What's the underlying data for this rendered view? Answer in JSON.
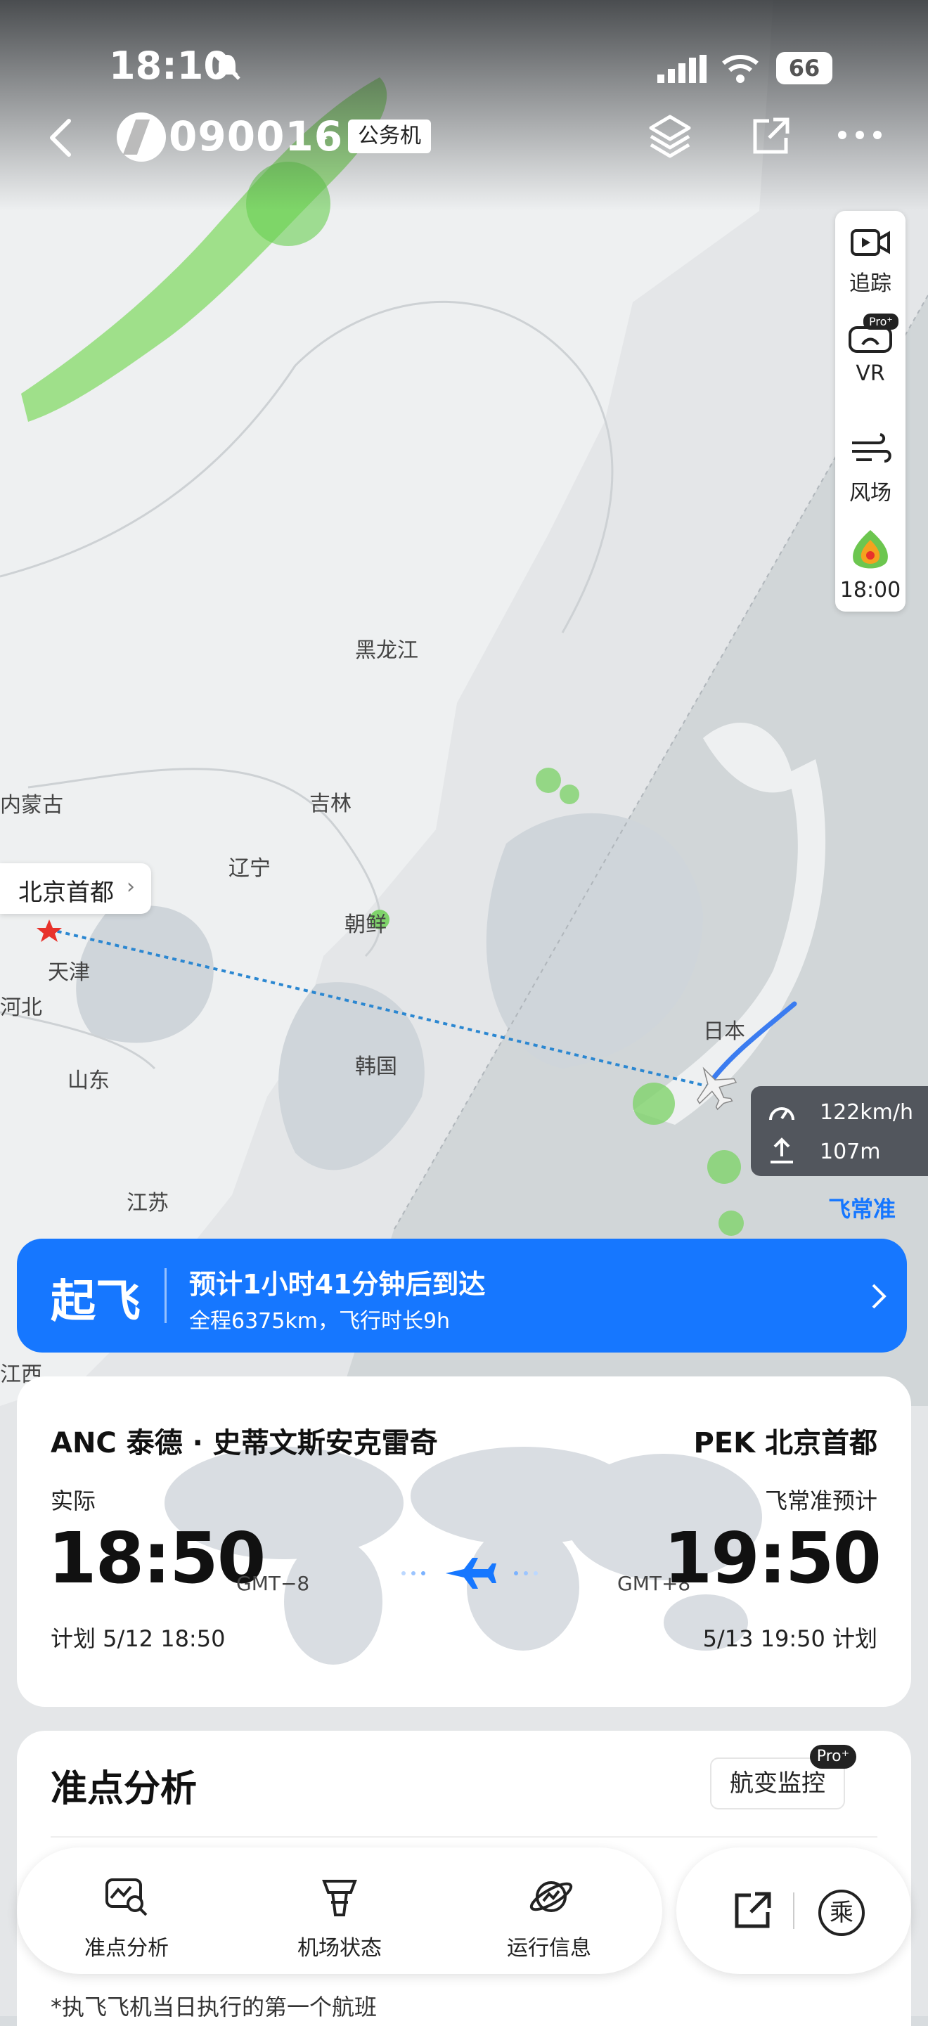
{
  "status": {
    "time": "18:10",
    "battery": "66"
  },
  "header": {
    "flight_no": "090016",
    "tag": "公务机"
  },
  "right_panel": {
    "track": "追踪",
    "vr": "VR",
    "vr_badge": "Pro⁺",
    "wind": "风场",
    "weather_time": "18:00"
  },
  "map": {
    "origin_label": "北京首都",
    "regions": [
      "黑龙江",
      "吉林",
      "辽宁",
      "内蒙古",
      "朝鲜",
      "天津",
      "河北",
      "山东",
      "韩国",
      "日本",
      "江苏",
      "江西"
    ],
    "speed": "122km/h",
    "altitude": "107m",
    "brand": "飞常准"
  },
  "status_banner": {
    "state": "起飞",
    "eta": "预计1小时41分钟后到达",
    "summary": "全程6375km，飞行时长9h"
  },
  "flight": {
    "dep_airport": "ANC 泰德 · 史蒂文斯安克雷奇",
    "arr_airport": "PEK 北京首都",
    "dep_type": "实际",
    "arr_type": "飞常准预计",
    "dep_time": "18:50",
    "arr_time": "19:50",
    "dep_tz": "GMT−8",
    "arr_tz": "GMT+8",
    "dep_plan": "计划 5/12 18:50",
    "arr_plan": "5/13 19:50 计划"
  },
  "analysis": {
    "title": "准点分析",
    "monitor": "航变监控",
    "pro": "Pro⁺",
    "footnote": "*执飞飞机当日执行的第一个航班"
  },
  "tabs": [
    {
      "label": "准点分析"
    },
    {
      "label": "机场状态"
    },
    {
      "label": "运行信息"
    }
  ],
  "actions": {
    "ride": "乘"
  },
  "colors": {
    "accent": "#1677ff",
    "route": "#2b87d1",
    "radar": "#7fd36b"
  }
}
